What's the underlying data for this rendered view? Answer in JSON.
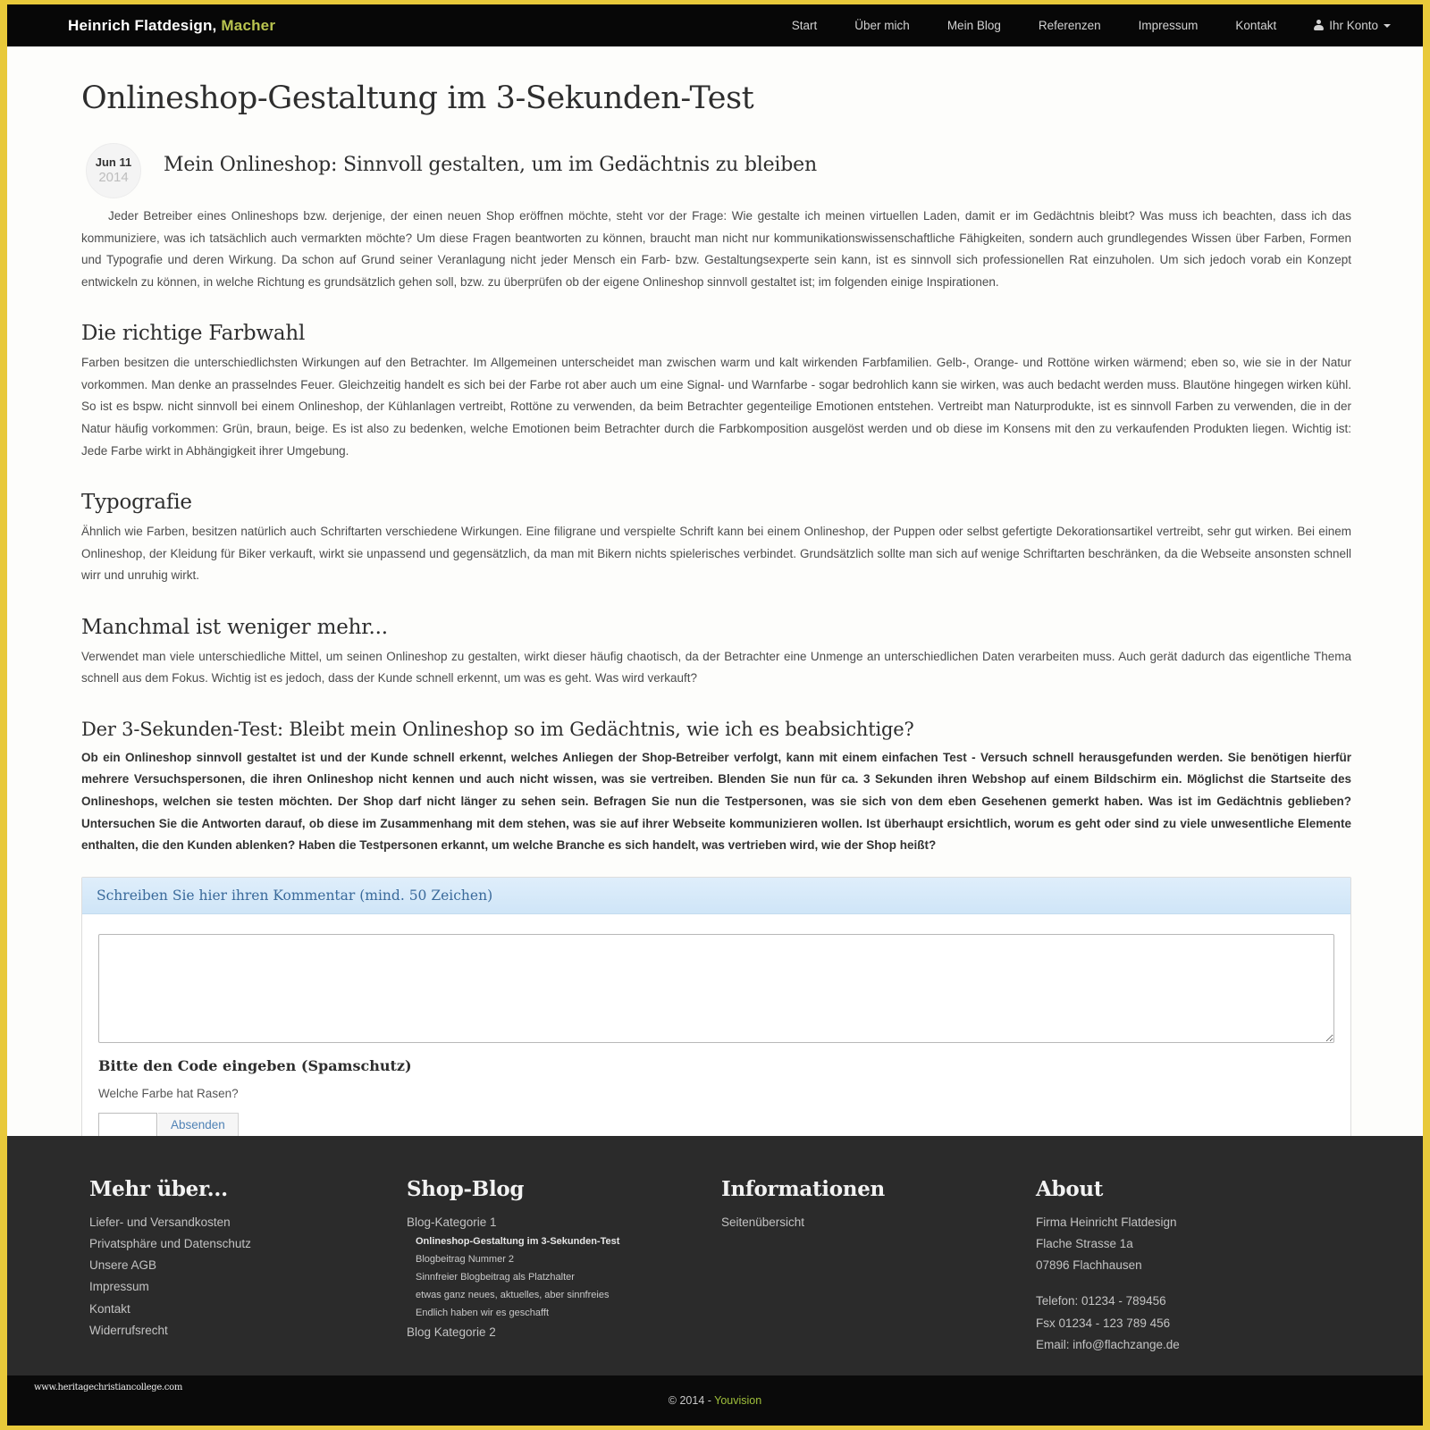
{
  "nav": {
    "brand_main": "Heinrich Flatdesign,",
    "brand_accent": "Macher",
    "links": [
      "Start",
      "Über mich",
      "Mein Blog",
      "Referenzen",
      "Impressum",
      "Kontakt"
    ],
    "account_label": "Ihr Konto"
  },
  "page": {
    "title": "Onlineshop-Gestaltung im 3-Sekunden-Test"
  },
  "post": {
    "date_day": "Jun 11",
    "date_year": "2014",
    "title": "Mein Onlineshop: Sinnvoll gestalten, um im Gedächtnis zu bleiben",
    "intro": "Jeder Betreiber eines Onlineshops bzw. derjenige, der einen neuen Shop eröffnen möchte, steht vor der Frage: Wie gestalte ich meinen virtuellen Laden, damit er im Gedächtnis bleibt? Was muss ich beachten, dass ich das kommuniziere, was ich tatsächlich auch vermarkten möchte? Um diese Fragen beantworten zu können, braucht man nicht nur kommunikationswissenschaftliche Fähigkeiten, sondern auch grundlegendes Wissen über Farben, Formen und Typografie und deren Wirkung. Da schon auf Grund seiner Veranlagung nicht jeder Mensch ein Farb- bzw. Gestaltungsexperte sein kann, ist es sinnvoll sich professionellen Rat einzuholen. Um sich jedoch vorab ein Konzept entwickeln zu können, in welche Richtung es grundsätzlich gehen soll, bzw. zu überprüfen ob der eigene Onlineshop sinnvoll gestaltet ist; im folgenden einige Inspirationen."
  },
  "sections": [
    {
      "heading": "Die richtige Farbwahl",
      "text": "Farben besitzen die unterschiedlichsten Wirkungen auf den Betrachter. Im Allgemeinen unterscheidet man zwischen warm und kalt wirkenden Farbfamilien. Gelb-, Orange- und Rottöne wirken wärmend; eben so, wie sie in der Natur vorkommen. Man denke an prasselndes Feuer. Gleichzeitig handelt es sich bei der Farbe rot aber auch um eine Signal- und Warnfarbe - sogar bedrohlich kann sie wirken, was auch bedacht werden muss. Blautöne hingegen wirken kühl. So ist es bspw. nicht sinnvoll bei einem Onlineshop, der Kühlanlagen vertreibt, Rottöne zu verwenden, da beim Betrachter gegenteilige Emotionen entstehen. Vertreibt man Naturprodukte, ist es sinnvoll Farben zu verwenden, die in der Natur häufig vorkommen: Grün, braun, beige. Es ist also zu bedenken, welche Emotionen beim Betrachter durch die Farbkomposition ausgelöst werden und ob diese im Konsens mit den zu verkaufenden Produkten liegen. Wichtig ist: Jede Farbe wirkt in Abhängigkeit ihrer Umgebung."
    },
    {
      "heading": "Typografie",
      "text": "Ähnlich wie Farben, besitzen natürlich auch Schriftarten verschiedene Wirkungen. Eine filigrane und verspielte Schrift kann bei einem Onlineshop, der Puppen oder selbst gefertigte Dekorationsartikel vertreibt, sehr gut wirken. Bei einem Onlineshop, der Kleidung für Biker verkauft, wirkt sie unpassend und gegensätzlich, da man mit Bikern nichts spielerisches verbindet. Grundsätzlich sollte man sich auf wenige Schriftarten beschränken, da die Webseite ansonsten schnell wirr und unruhig wirkt."
    },
    {
      "heading": "Manchmal ist weniger mehr...",
      "text": "Verwendet man viele unterschiedliche Mittel, um seinen Onlineshop zu gestalten, wirkt dieser häufig chaotisch, da der Betrachter eine Unmenge an unterschiedlichen Daten verarbeiten muss. Auch gerät dadurch das eigentliche Thema schnell aus dem Fokus. Wichtig ist es jedoch, dass der Kunde schnell erkennt, um was es geht. Was wird verkauft?"
    }
  ],
  "test_section": {
    "heading": "Der 3-Sekunden-Test: Bleibt mein Onlineshop so im Gedächtnis, wie ich es beabsichtige?",
    "text": "Ob ein Onlineshop sinnvoll gestaltet ist und der Kunde schnell erkennt, welches Anliegen der Shop-Betreiber verfolgt, kann mit einem einfachen Test - Versuch schnell herausgefunden werden. Sie benötigen hierfür mehrere Versuchspersonen, die ihren Onlineshop nicht kennen und auch nicht wissen, was sie vertreiben. Blenden Sie nun für ca. 3 Sekunden ihren Webshop auf einem Bildschirm ein. Möglichst die Startseite des Onlineshops, welchen sie testen möchten. Der Shop darf nicht länger zu sehen sein. Befragen Sie nun die Testpersonen, was sie sich von dem eben Gesehenen gemerkt haben. Was ist im Gedächtnis geblieben? Untersuchen Sie die Antworten darauf, ob diese im Zusammenhang mit dem stehen, was sie auf ihrer Webseite kommunizieren wollen. Ist überhaupt ersichtlich, worum es geht oder sind zu viele unwesentliche Elemente enthalten, die den Kunden ablenken? Haben die Testpersonen erkannt, um welche Branche es sich handelt, was vertrieben wird, wie der Shop heißt?"
  },
  "comment_form": {
    "header": "Schreiben Sie hier ihren Kommentar (mind. 50 Zeichen)",
    "textarea_value": "",
    "textarea_placeholder": "",
    "code_label": "Bitte den Code eingeben (Spamschutz)",
    "code_question": "Welche Farbe hat Rasen?",
    "code_value": "",
    "submit_label": "Absenden"
  },
  "footer": {
    "col1": {
      "heading": "Mehr über...",
      "links": [
        "Liefer- und Versandkosten",
        "Privatsphäre und Datenschutz",
        "Unsere AGB",
        "Impressum",
        "Kontakt",
        "Widerrufsrecht"
      ]
    },
    "col2": {
      "heading": "Shop-Blog",
      "category1": "Blog-Kategorie 1",
      "posts": [
        "Onlineshop-Gestaltung im 3-Sekunden-Test",
        "Blogbeitrag Nummer 2",
        "Sinnfreier Blogbeitrag als Platzhalter",
        "etwas ganz neues, aktuelles, aber sinnfreies",
        "Endlich haben wir es geschafft"
      ],
      "category2": "Blog Kategorie 2"
    },
    "col3": {
      "heading": "Informationen",
      "links": [
        "Seitenübersicht"
      ]
    },
    "col4": {
      "heading": "About",
      "company": "Firma Heinricht Flatdesign",
      "street": "Flache Strasse 1a",
      "city": "07896 Flachhausen",
      "phone": "Telefon: 01234 - 789456",
      "fax": "Fsx 01234 - 123 789 456",
      "email": "Email: info@flachzange.de"
    }
  },
  "bottom": {
    "watermark": "www.heritagechristiancollege.com",
    "copyright_prefix": "© 2014 - ",
    "copyright_brand": "Youvision"
  },
  "colors": {
    "page_border": "#e8c93a",
    "nav_bg": "#070707",
    "brand_accent": "#b9c44f",
    "footer_bg": "#2b2b2b",
    "bottom_bg": "#0a0a0a",
    "panel_head_text": "#3a6a9b",
    "link_blue": "#4f82b5",
    "copyright_brand": "#9fbf3b"
  }
}
